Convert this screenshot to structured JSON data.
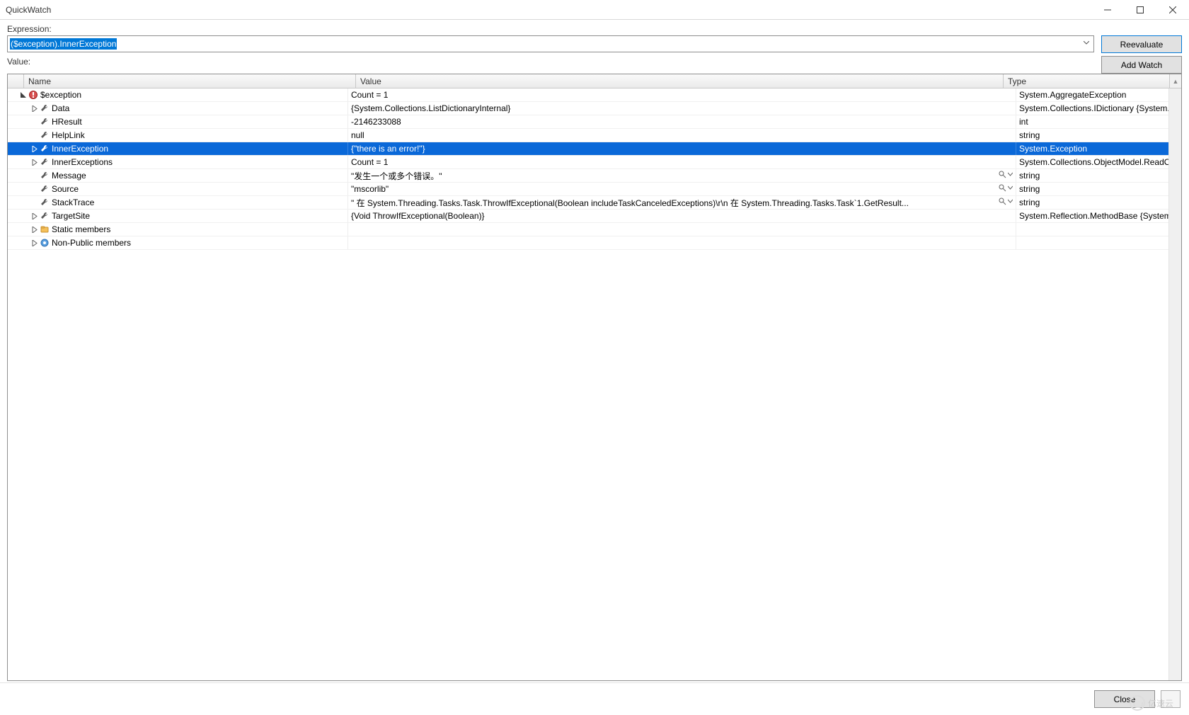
{
  "window": {
    "title": "QuickWatch"
  },
  "labels": {
    "expression": "Expression:",
    "value": "Value:"
  },
  "expression": {
    "value": "($exception).InnerException"
  },
  "buttons": {
    "reevaluate": "Reevaluate",
    "add_watch": "Add Watch",
    "close": "Close"
  },
  "columns": {
    "name": "Name",
    "value": "Value",
    "type": "Type"
  },
  "rows": [
    {
      "depth": 0,
      "expander": "open",
      "icon": "exception",
      "name": "$exception",
      "value": "Count = 1",
      "type": "System.AggregateException"
    },
    {
      "depth": 1,
      "expander": "closed",
      "icon": "wrench",
      "name": "Data",
      "value": "{System.Collections.ListDictionaryInternal}",
      "type": "System.Collections.IDictionary {System.Collectio..."
    },
    {
      "depth": 1,
      "expander": "none",
      "icon": "wrench",
      "name": "HResult",
      "value": "-2146233088",
      "type": "int"
    },
    {
      "depth": 1,
      "expander": "none",
      "icon": "wrench",
      "name": "HelpLink",
      "value": "null",
      "type": "string"
    },
    {
      "depth": 1,
      "expander": "closed",
      "icon": "wrench",
      "name": "InnerException",
      "value": "{\"there is an error!\"}",
      "type": "System.Exception",
      "selected": true
    },
    {
      "depth": 1,
      "expander": "closed",
      "icon": "wrench",
      "name": "InnerExceptions",
      "value": "Count = 1",
      "type": "System.Collections.ObjectModel.ReadOnlyColle..."
    },
    {
      "depth": 1,
      "expander": "none",
      "icon": "wrench",
      "name": "Message",
      "value": "\"发生一个或多个错误。\"",
      "type": "string",
      "visualizer": true
    },
    {
      "depth": 1,
      "expander": "none",
      "icon": "wrench",
      "name": "Source",
      "value": "\"mscorlib\"",
      "type": "string",
      "visualizer": true
    },
    {
      "depth": 1,
      "expander": "none",
      "icon": "wrench",
      "name": "StackTrace",
      "value": "\"   在 System.Threading.Tasks.Task.ThrowIfExceptional(Boolean includeTaskCanceledExceptions)\\r\\n   在 System.Threading.Tasks.Task`1.GetResult...",
      "type": "string",
      "visualizer": true
    },
    {
      "depth": 1,
      "expander": "closed",
      "icon": "wrench",
      "name": "TargetSite",
      "value": "{Void ThrowIfExceptional(Boolean)}",
      "type": "System.Reflection.MethodBase {System.Reflectio..."
    },
    {
      "depth": 1,
      "expander": "closed",
      "icon": "static",
      "name": "Static members",
      "value": "",
      "type": ""
    },
    {
      "depth": 1,
      "expander": "closed",
      "icon": "nonpublic",
      "name": "Non-Public members",
      "value": "",
      "type": ""
    }
  ],
  "watermark": "亿速云"
}
